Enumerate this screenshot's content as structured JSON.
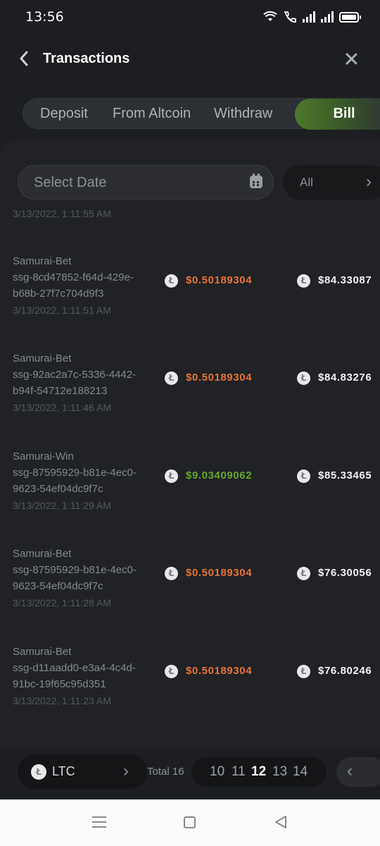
{
  "status": {
    "time": "13:56"
  },
  "header": {
    "title": "Transactions"
  },
  "tabs": [
    {
      "label": "Deposit"
    },
    {
      "label": "From Altcoin"
    },
    {
      "label": "Withdraw"
    },
    {
      "label": "Bill"
    }
  ],
  "filters": {
    "date_placeholder": "Select Date",
    "type_value": "All"
  },
  "partial_row_date": "3/13/2022, 1:11:55 AM",
  "transactions": [
    {
      "name": "Samurai-Bet",
      "id_line1": "ssg-8cd47852-f64d-429e-",
      "id_line2": "b68b-27f7c704d9f3",
      "date": "3/13/2022, 1:11:51 AM",
      "amount": "$0.50189304",
      "balance": "$84.33087",
      "kind": "bet"
    },
    {
      "name": "Samurai-Bet",
      "id_line1": "ssg-92ac2a7c-5336-4442-",
      "id_line2": "b94f-54712e188213",
      "date": "3/13/2022, 1:11:46 AM",
      "amount": "$0.50189304",
      "balance": "$84.83276",
      "kind": "bet"
    },
    {
      "name": "Samurai-Win",
      "id_line1": "ssg-87595929-b81e-4ec0-",
      "id_line2": "9623-54ef04dc9f7c",
      "date": "3/13/2022, 1:11:29 AM",
      "amount": "$9.03409062",
      "balance": "$85.33465",
      "kind": "win"
    },
    {
      "name": "Samurai-Bet",
      "id_line1": "ssg-87595929-b81e-4ec0-",
      "id_line2": "9623-54ef04dc9f7c",
      "date": "3/13/2022, 1:11:28 AM",
      "amount": "$0.50189304",
      "balance": "$76.30056",
      "kind": "bet"
    },
    {
      "name": "Samurai-Bet",
      "id_line1": "ssg-d11aadd0-e3a4-4c4d-",
      "id_line2": "91bc-19f65c95d351",
      "date": "3/13/2022, 1:11:23 AM",
      "amount": "$0.50189304",
      "balance": "$76.80246",
      "kind": "bet"
    }
  ],
  "footer": {
    "currency": "LTC",
    "total_label": "Total 16",
    "pages": [
      "10",
      "11",
      "12",
      "13",
      "14"
    ],
    "current_page": "12"
  },
  "colors": {
    "bet": "#e8733a",
    "win": "#64a82e",
    "active_tab": "#4e7a2a"
  }
}
